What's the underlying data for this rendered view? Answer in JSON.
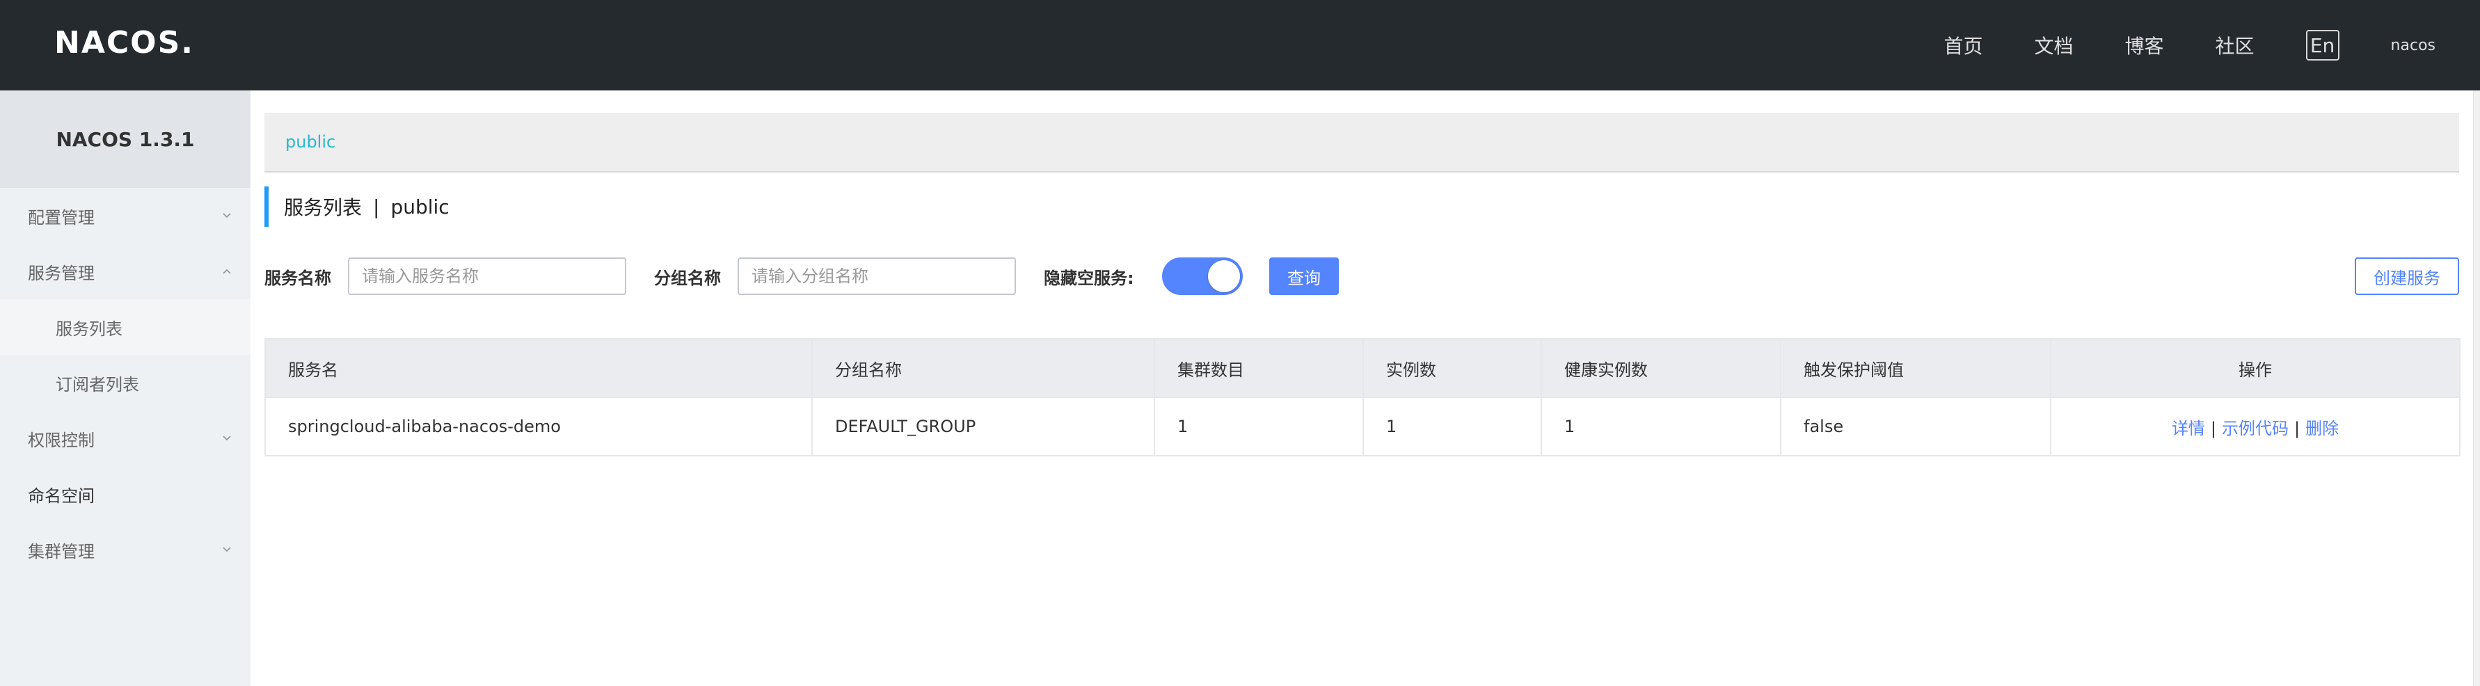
{
  "header": {
    "logo_text": "NACOS.",
    "nav": [
      {
        "label": "首页"
      },
      {
        "label": "文档"
      },
      {
        "label": "博客"
      },
      {
        "label": "社区"
      }
    ],
    "lang_toggle": "En",
    "user": "nacos",
    "bg_color": "#252a2f"
  },
  "sidebar": {
    "title": "NACOS 1.3.1",
    "items": [
      {
        "label": "配置管理",
        "icon": "chevron-down-icon"
      },
      {
        "label": "服务管理",
        "icon": "chevron-up-icon"
      },
      {
        "label": "服务列表"
      },
      {
        "label": "订阅者列表"
      },
      {
        "label": "权限控制",
        "icon": "chevron-down-icon"
      },
      {
        "label": "命名空间"
      },
      {
        "label": "集群管理",
        "icon": "chevron-down-icon"
      }
    ]
  },
  "namespace": {
    "current": "public"
  },
  "page": {
    "title": "服务列表",
    "separator": "|",
    "namespace": "public"
  },
  "filters": {
    "service_name_label": "服务名称",
    "service_name_placeholder": "请输入服务名称",
    "group_name_label": "分组名称",
    "group_name_placeholder": "请输入分组名称",
    "hide_empty_label": "隐藏空服务:",
    "hide_empty_on": true,
    "query_button": "查询",
    "create_button": "创建服务"
  },
  "table": {
    "columns": [
      "服务名",
      "分组名称",
      "集群数目",
      "实例数",
      "健康实例数",
      "触发保护阈值",
      "操作"
    ],
    "rows": [
      {
        "service": "springcloud-alibaba-nacos-demo",
        "group": "DEFAULT_GROUP",
        "clusters": "1",
        "instances": "1",
        "healthy": "1",
        "threshold": "false",
        "actions": {
          "detail": "详情",
          "sample": "示例代码",
          "delete": "删除",
          "sep": "|"
        }
      }
    ]
  },
  "colors": {
    "accent": "#5584ff",
    "namespace_link": "#2ab7d0",
    "title_bar": "#209bfa"
  }
}
